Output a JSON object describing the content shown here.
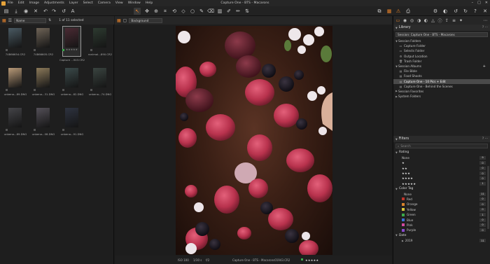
{
  "app": {
    "window_title": "Capture One - BTS - Macarons",
    "menu": [
      "File",
      "Edit",
      "Image",
      "Adjustments",
      "Layer",
      "Select",
      "Camera",
      "View",
      "Window",
      "Help"
    ]
  },
  "browser": {
    "sort_value": "Name",
    "selection_count": "1 of 11 selected",
    "thumbs": [
      {
        "name": "74B66654.CR2",
        "color": "#4a5a63",
        "selected": false
      },
      {
        "name": "74B66605.CR2",
        "color": "#6f6457",
        "selected": false
      },
      {
        "name": "Capture ...943.CR2",
        "color": "#4a2a33",
        "selected": true
      },
      {
        "name": "ronimal...890.CR2",
        "color": "#2d3a30",
        "selected": false
      },
      {
        "name": "unbena...89.DNG",
        "color": "#b89a78",
        "selected": false
      },
      {
        "name": "unbena...31.DNG",
        "color": "#8c7a5a",
        "selected": false
      },
      {
        "name": "unbena...82.DNG",
        "color": "#3b4a4a",
        "selected": false
      },
      {
        "name": "unbena...74.DNG",
        "color": "#3a4440",
        "selected": false
      },
      {
        "name": "unbena...89.DNG",
        "color": "#444448",
        "selected": false
      },
      {
        "name": "unbena...08.DNG",
        "color": "#545058",
        "selected": false
      },
      {
        "name": "unbena...91.DNG",
        "color": "#2e3340",
        "selected": false
      }
    ],
    "selected_stars": "★★★★★"
  },
  "viewer": {
    "background_value": "Background",
    "status": {
      "iso": "ISO 100",
      "shutter": "1/30 s",
      "aperture": "f/2",
      "filename": "Capture One - BTS - Macarons01943.CR2"
    }
  },
  "library": {
    "title": "Library",
    "session_select": "Session: Capture One - BTS - Macarons",
    "items": [
      {
        "label": "Session Folders",
        "icon": "twist-open",
        "level": 0
      },
      {
        "label": "Capture Folder",
        "icon": "folder-icon",
        "level": 1
      },
      {
        "label": "Selects Folder",
        "icon": "folder-icon",
        "level": 1
      },
      {
        "label": "Output Location",
        "icon": "gear-icon",
        "level": 1
      },
      {
        "label": "Trash Folder",
        "icon": "trash-icon",
        "level": 1
      },
      {
        "label": "Session Albums",
        "icon": "twist-open",
        "level": 0
      },
      {
        "label": "File Bible",
        "icon": "album-icon",
        "level": 1
      },
      {
        "label": "Food Shoots",
        "icon": "album-icon",
        "level": 1
      },
      {
        "label": "Capture One - 10 Pics + Edit",
        "icon": "album-icon",
        "level": 1,
        "highlighted": true
      },
      {
        "label": "Capture One - Behind the Scenes",
        "icon": "album-icon",
        "level": 1
      },
      {
        "label": "Session Favorites",
        "icon": "twist-closed",
        "level": 0
      },
      {
        "label": "System Folders",
        "icon": "twist-closed",
        "level": 0
      }
    ]
  },
  "filters": {
    "title": "Filters",
    "search_placeholder": "Search",
    "rating_title": "Rating",
    "ratings": [
      {
        "label": "None",
        "count": "9"
      },
      {
        "label": "★",
        "count": "0"
      },
      {
        "label": "★★",
        "count": "0"
      },
      {
        "label": "★★★",
        "count": "0"
      },
      {
        "label": "★★★★",
        "count": "0"
      },
      {
        "label": "★★★★★",
        "count": "1"
      }
    ],
    "color_title": "Color Tag",
    "colors": [
      {
        "label": "None",
        "count": "11",
        "color": ""
      },
      {
        "label": "Red",
        "count": "0",
        "color": "#c0352b"
      },
      {
        "label": "Orange",
        "count": "0",
        "color": "#d9822b"
      },
      {
        "label": "Yellow",
        "count": "0",
        "color": "#d6c43a"
      },
      {
        "label": "Green",
        "count": "1",
        "color": "#3aa84a"
      },
      {
        "label": "Blue",
        "count": "0",
        "color": "#3a6fd1"
      },
      {
        "label": "Pink",
        "count": "0",
        "color": "#d14aa0"
      },
      {
        "label": "Purple",
        "count": "0",
        "color": "#8a4ad1"
      }
    ],
    "date_title": "Date",
    "date_year": "2019",
    "date_count": "11"
  }
}
